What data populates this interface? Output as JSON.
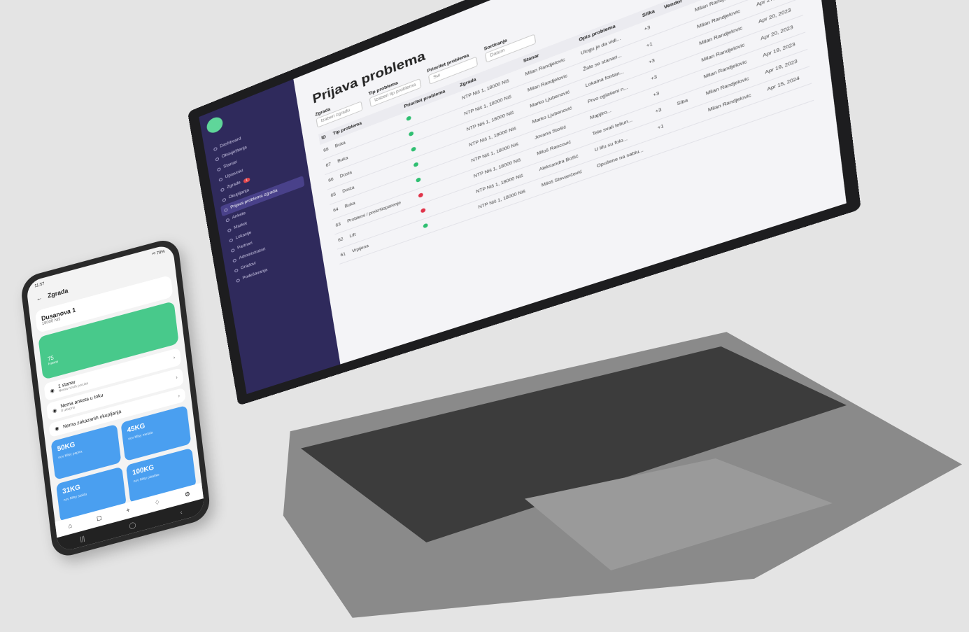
{
  "laptop": {
    "sidebar": {
      "items": [
        {
          "label": "Dashboard"
        },
        {
          "label": "Obavještenja"
        },
        {
          "label": "Stanari"
        },
        {
          "label": "Upravnici"
        },
        {
          "label": "Zgrade",
          "badge": "1"
        },
        {
          "label": "Okupljanja"
        },
        {
          "label": "Prijava problema zgrada",
          "active": true
        },
        {
          "label": "Ankete"
        },
        {
          "label": "Market"
        },
        {
          "label": "Lokacije"
        },
        {
          "label": "Partneri"
        },
        {
          "label": "Administratori"
        },
        {
          "label": "Gradovi"
        },
        {
          "label": "Podešavanja"
        }
      ]
    },
    "page_title": "Prijava problema",
    "filters": {
      "zgrada": {
        "label": "Zgrada",
        "placeholder": "Izaberi zgradu"
      },
      "tip": {
        "label": "Tip problema",
        "placeholder": "Izaberi tip problema"
      },
      "prioritet": {
        "label": "Prioritet problema",
        "value": "Svi"
      },
      "sortiranje": {
        "label": "Sortiranje",
        "value": "Datum"
      }
    },
    "table": {
      "headers": [
        "ID",
        "Tip problema",
        "Prioritet problema",
        "Zgrada",
        "Stanar",
        "Opis problema",
        "Slika",
        "Vendor",
        "Upravnik",
        "Kreirano"
      ],
      "rows": [
        {
          "id": "68",
          "tip": "Buka",
          "prio": "#2fbf71",
          "zgrada": "NTP Niš 1, 18000 Niš",
          "stanar": "Milan Randjelovic",
          "opis": "Ulogu je da vidi...",
          "slika": "+3",
          "vendor": "",
          "upravnik": "Milan Randjelovic",
          "kreirano": "Apr 27, 2023"
        },
        {
          "id": "67",
          "tip": "Buka",
          "prio": "#2fbf71",
          "zgrada": "NTP Niš 1, 18000 Niš",
          "stanar": "Milan Randjelovic",
          "opis": "Žale se stanari...",
          "slika": "+1",
          "vendor": "",
          "upravnik": "Milan Randjelovic",
          "kreirano": "Apr 27, 2023"
        },
        {
          "id": "66",
          "tip": "Dosta",
          "prio": "#2fbf71",
          "zgrada": "NTP Niš 1, 18000 Niš",
          "stanar": "Marko Ljubenović",
          "opis": "Lokalna fontan...",
          "slika": "+3",
          "vendor": "",
          "upravnik": "Milan Randjelovic",
          "kreirano": "Apr 20, 2023"
        },
        {
          "id": "65",
          "tip": "Dosta",
          "prio": "#2fbf71",
          "zgrada": "NTP Niš 1, 18000 Niš",
          "stanar": "Marko Ljubenović",
          "opis": "Prvo oglašeni n...",
          "slika": "+3",
          "vendor": "",
          "upravnik": "Milan Randjelovic",
          "kreirano": "Apr 20, 2023"
        },
        {
          "id": "64",
          "tip": "Buka",
          "prio": "#2fbf71",
          "zgrada": "NTP Niš 1, 18000 Niš",
          "stanar": "Jovana Stošić",
          "opis": "Mapjiro...",
          "slika": "+3",
          "vendor": "",
          "upravnik": "Milan Randjelovic",
          "kreirano": "Apr 19, 2023"
        },
        {
          "id": "63",
          "tip": "Problemi / prekršioparenje",
          "prio": "#e0344a",
          "zgrada": "NTP Niš 1, 18000 Niš",
          "stanar": "Miloš Rancović",
          "opis": "Tele svali tebun...",
          "slika": "+3",
          "vendor": "Siba",
          "upravnik": "Milan Randjelovic",
          "kreirano": "Apr 19, 2023"
        },
        {
          "id": "62",
          "tip": "Lift",
          "prio": "#e0344a",
          "zgrada": "NTP Niš 1, 18000 Niš",
          "stanar": "Aleksandra Bošić",
          "opis": "U lifu su folo...",
          "slika": "+1",
          "vendor": "",
          "upravnik": "Milan Randjelovic",
          "kreirano": "Apr 15, 2024"
        },
        {
          "id": "61",
          "tip": "Vrpijena",
          "prio": "#2fbf71",
          "zgrada": "NTP Niš 1, 18000 Niš",
          "stanar": "Miloš Stevančević",
          "opis": "Opušene na sablu...",
          "slika": "",
          "vendor": "",
          "upravnik": "",
          "kreirano": ""
        }
      ]
    }
  },
  "phone": {
    "status_time": "11:57",
    "status_icons": "⁴ᴳ 78%",
    "header_title": "Zgrada",
    "building": {
      "name": "Dusanova 1",
      "city": "18000 Niš"
    },
    "green_card": {
      "value": "75",
      "label": "Ivanov"
    },
    "rows": [
      {
        "title": "1 stanar",
        "subtitle": "Nema novih poruka"
      },
      {
        "title": "Nema anketa u toku",
        "subtitle": "0 ukupno"
      },
      {
        "title": "Nema zakazanih okupljanja",
        "subtitle": ""
      }
    ],
    "tiles": [
      {
        "kg": "50KG",
        "label": "nov Mlsy papira"
      },
      {
        "kg": "45KG",
        "label": "nov Mlsy metala"
      },
      {
        "kg": "31KG",
        "label": "nov Mlsy stakla"
      },
      {
        "kg": "100KG",
        "label": "nov Mlsy plastike"
      }
    ],
    "nav": [
      "⌂",
      "◻",
      "+",
      "♢",
      "⚙"
    ],
    "sysnav": [
      "|||",
      "◯",
      "‹"
    ]
  }
}
